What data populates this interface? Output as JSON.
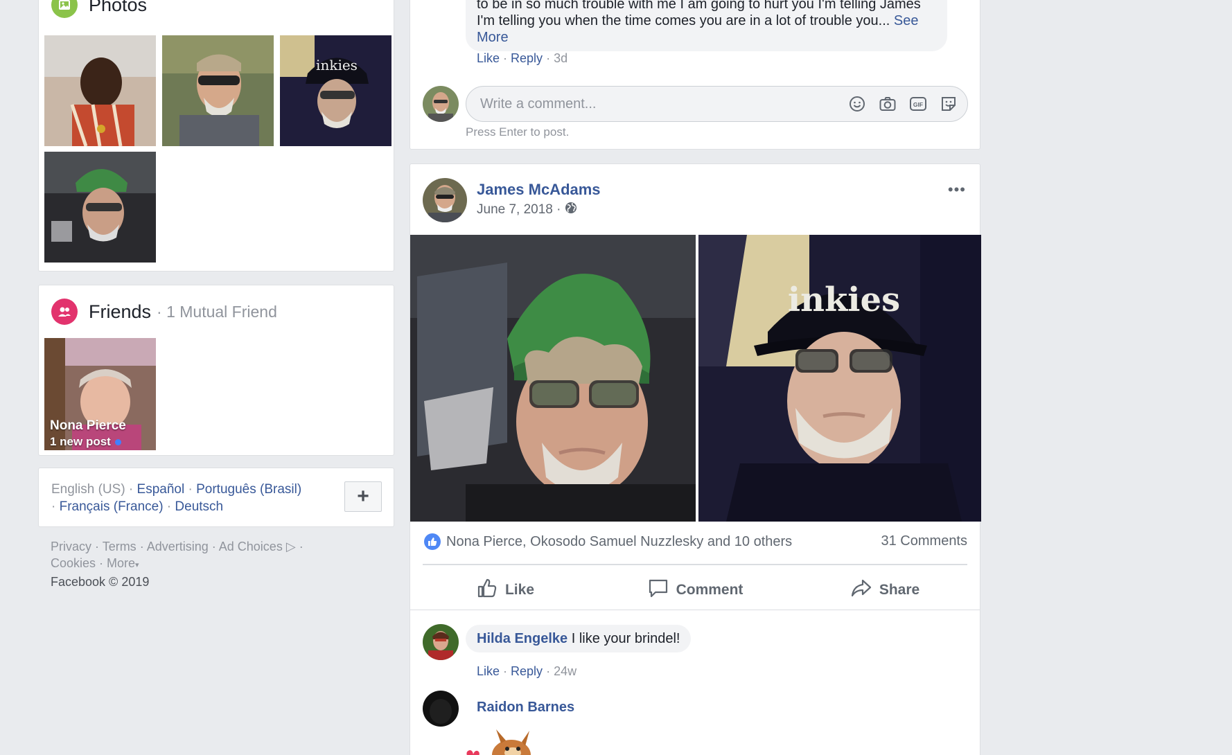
{
  "photos": {
    "title": "Photos"
  },
  "friends": {
    "title": "Friends",
    "mutual": "· 1 Mutual Friend",
    "tile": {
      "name": "Nona Pierce",
      "status": "1 new post"
    }
  },
  "languages": {
    "current": "English (US) · ",
    "items": [
      "Español",
      "Português (Brasil)",
      "Français (France)",
      "Deutsch"
    ],
    "sep": " · ",
    "add_label": "+"
  },
  "footer": {
    "links": [
      "Privacy",
      "Terms",
      "Advertising",
      "Ad Choices",
      "Cookies",
      "More"
    ],
    "copyright": "Facebook © 2019"
  },
  "previous_comment": {
    "text": "to be in so much trouble with me I am going to hurt you I'm telling James I'm telling you when the time comes you are in a lot of trouble you...",
    "see_more": "See More",
    "like": "Like",
    "reply": "Reply",
    "age": "3d"
  },
  "composer": {
    "placeholder": "Write a comment...",
    "hint": "Press Enter to post."
  },
  "post": {
    "author": "James McAdams",
    "date": "June 7, 2018 ·",
    "more": "•••",
    "reactions_text": "Nona Pierce, Okosodo Samuel Nuzzlesky and 10 others",
    "comments_count": "31 Comments",
    "actions": {
      "like": "Like",
      "comment": "Comment",
      "share": "Share"
    }
  },
  "comments": [
    {
      "name": "Hilda Engelke",
      "text": "I like your brindel!",
      "like": "Like",
      "reply": "Reply",
      "age": "24w"
    },
    {
      "name": "Raidon Barnes"
    }
  ],
  "colors": {
    "link": "#385898",
    "background": "#e9ebee",
    "photos_icon": "#8bc34a",
    "friends_icon": "#e2336d",
    "like_badge": "#4f88f5"
  }
}
